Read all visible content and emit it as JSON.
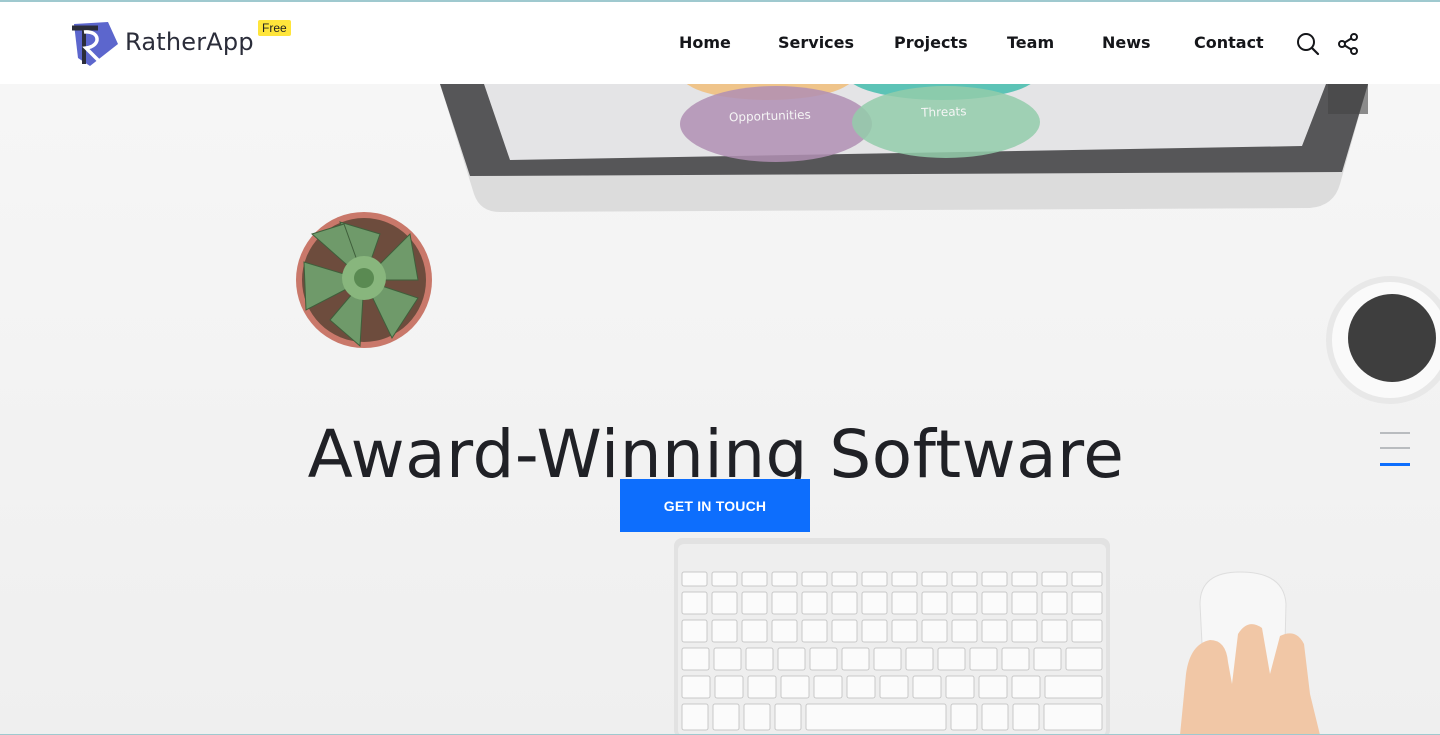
{
  "brand": {
    "name": "RatherApp",
    "badge": "Free",
    "badge_color": "#ffe53b",
    "mark_colors": [
      "#4a55c8",
      "#7b6be0"
    ]
  },
  "nav": {
    "items": [
      {
        "label": "Home"
      },
      {
        "label": "Services"
      },
      {
        "label": "Projects"
      },
      {
        "label": "Team"
      },
      {
        "label": "News"
      },
      {
        "label": "Contact"
      }
    ],
    "icons": [
      "search-icon",
      "share-icon"
    ]
  },
  "hero": {
    "headline": "Award-Winning Software",
    "cta_label": "GET IN TOUCH",
    "accent": "#0d6efd",
    "screen_labels": [
      "Opportunities",
      "Threats"
    ]
  },
  "side_menu": {
    "icon": "hamburger-icon",
    "active_color": "#0d6efd"
  }
}
